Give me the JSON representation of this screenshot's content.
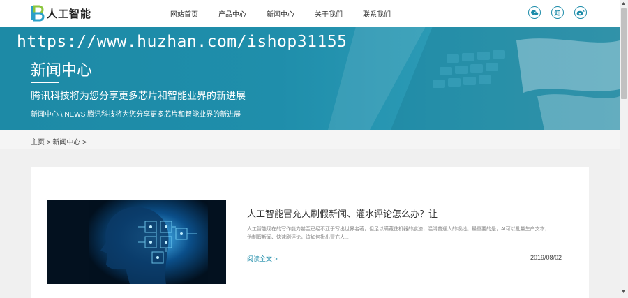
{
  "header": {
    "logo_text": "人工智能",
    "nav": [
      "网站首页",
      "产品中心",
      "新闻中心",
      "关于我们",
      "联系我们"
    ],
    "social": {
      "wechat_icon": "wechat-icon",
      "zhihu_glyph": "知",
      "weibo_icon": "weibo-icon"
    }
  },
  "hero": {
    "watermark": "https://www.huzhan.com/ishop31155",
    "title": "新闻中心",
    "subtitle": "腾讯科技将为您分享更多芯片和智能业界的新进展",
    "crumb": "新闻中心 \\ NEWS 腾讯科技将为您分享更多芯片和智能业界的新进展"
  },
  "breadcrumb": {
    "home": "主页",
    "sep": " > ",
    "section": "新闻中心",
    "tail": " >"
  },
  "article": {
    "title": "人工智能冒充人刷假新闻、灌水评论怎么办？让",
    "desc": "人工智能现在的写作能力甚至已经不亚于写出世界名著，但足以瞒藏住机器的痕迹，混淆普通人的视线。最重要的是，AI可以批量生产文本，伪制假新闻、快速刷评论，该如何揪出冒充人...",
    "read_more": "阅读全文 >",
    "date": "2019/08/02"
  },
  "colors": {
    "accent": "#1a8aa8",
    "hero": "#1f8eab"
  }
}
